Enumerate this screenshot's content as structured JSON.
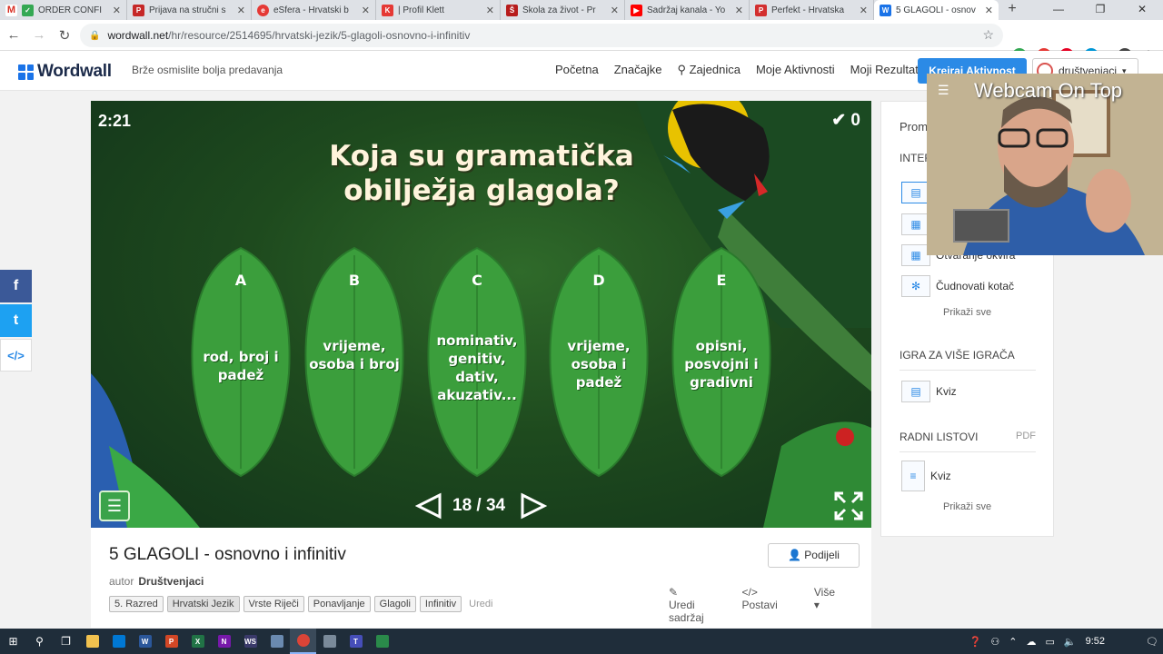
{
  "browser": {
    "tabs": [
      {
        "title": "ORDER CONFI",
        "favicon_color": "#d93025",
        "favicon_glyph": "M"
      },
      {
        "title": "Prijava na stručni s",
        "favicon_color": "#c62828",
        "favicon_glyph": "P"
      },
      {
        "title": "eSfera - Hrvatski b",
        "favicon_color": "#e53935",
        "favicon_glyph": "e"
      },
      {
        "title": "| Profil Klett",
        "favicon_color": "#e53935",
        "favicon_glyph": "K"
      },
      {
        "title": "Škola za život - Pr",
        "favicon_color": "#b71c1c",
        "favicon_glyph": "Š"
      },
      {
        "title": "Sadržaj kanala - Yo",
        "favicon_color": "#ff0000",
        "favicon_glyph": "▶"
      },
      {
        "title": "Perfekt - Hrvatska",
        "favicon_color": "#d32f2f",
        "favicon_glyph": "P"
      },
      {
        "title": "5 GLAGOLI - osnov",
        "favicon_color": "#1a73e8",
        "favicon_glyph": "W"
      }
    ],
    "new_tab": "+",
    "window_controls": {
      "minimize": "—",
      "maximize": "❐",
      "close": "✕"
    },
    "url_host": "wordwall.net",
    "url_path": "/hr/resource/2514695/hrvatski-jezik/5-glagoli-osnovno-i-infinitiv"
  },
  "site": {
    "logo": "Wordwall",
    "tagline": "Brže osmislite bolja predavanja",
    "nav": [
      "Početna",
      "Značajke",
      "Zajednica",
      "Moje Aktivnosti",
      "Moji Rezultati"
    ],
    "create_button": "Kreiraj Aktivnost",
    "user": "društvenjaci",
    "accent": "#2b8ae6"
  },
  "social": {
    "facebook": "f",
    "twitter": "t",
    "embed": "</>"
  },
  "game": {
    "timer": "2:21",
    "score": "0",
    "question": "Koja su gramatička obilježja glagola?",
    "answers": [
      {
        "letter": "A",
        "text": "rod, broj i padež"
      },
      {
        "letter": "B",
        "text": "vrijeme, osoba i broj"
      },
      {
        "letter": "C",
        "text": "nominativ, genitiv, dativ, akuzativ..."
      },
      {
        "letter": "D",
        "text": "vrijeme, osoba i padež"
      },
      {
        "letter": "E",
        "text": "opisni, posvojni i gradivni"
      }
    ],
    "counter": "18 / 34"
  },
  "info": {
    "title": "5 GLAGOLI - osnovno i infinitiv",
    "author_label": "autor",
    "author": "Društvenjaci",
    "share": "Podijeli",
    "tags": [
      "5. Razred",
      "Hrvatski Jezik",
      "Vrste Riječi",
      "Ponavljanje",
      "Glagoli",
      "Infinitiv"
    ],
    "edit_tags": "Uredi",
    "actions": [
      "Uredi sadržaj",
      "Postavi",
      "Više"
    ]
  },
  "panel": {
    "header": "Prom",
    "interactive_label": "INTER",
    "interactive_items": [
      "",
      "",
      "Otvaranje okvira",
      "Čudnovati kotač"
    ],
    "show_all_1": "Prikaži sve",
    "multiplayer_label": "IGRA ZA VIŠE IGRAČA",
    "multiplayer_items": [
      "Kviz"
    ],
    "worksheets_label": "RADNI LISTOVI",
    "pdf": "PDF",
    "worksheet_items": [
      "Kviz"
    ],
    "show_all_2": "Prikaži sve"
  },
  "webcam": {
    "title": "Webcam On Top"
  },
  "taskbar": {
    "time": "9:52"
  }
}
